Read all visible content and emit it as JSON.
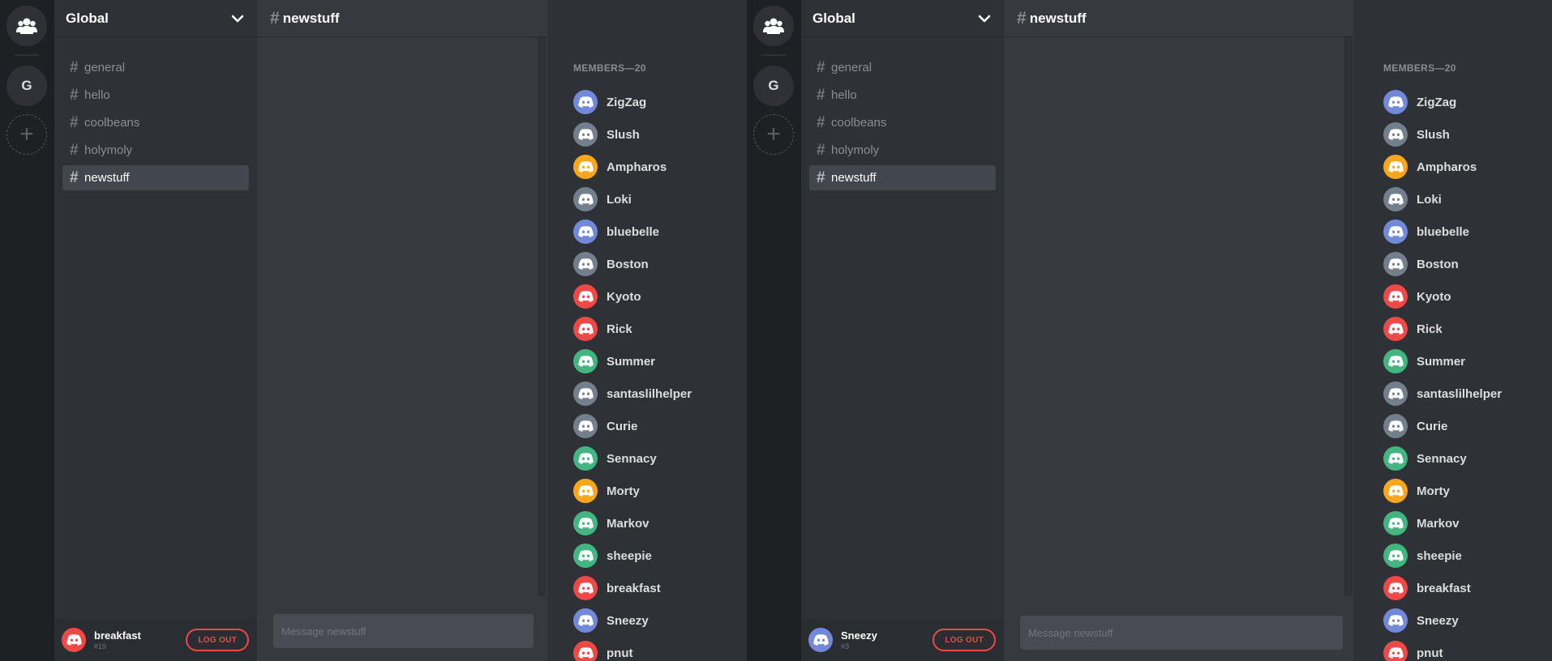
{
  "colors": {
    "blue": "#7289da",
    "grey": "#747f8d",
    "orange": "#faa61a",
    "red": "#f04747",
    "green": "#43b581"
  },
  "icons": {
    "home": "friends-icon",
    "add": "plus-icon",
    "dropdown": "chevron-down-icon",
    "avatar": "discord-logo-icon"
  },
  "panes": [
    {
      "server_initial": "G",
      "add_symbol": "+",
      "guild_name": "Global",
      "channels": [
        {
          "label": "general",
          "active": false
        },
        {
          "label": "hello",
          "active": false
        },
        {
          "label": "coolbeans",
          "active": false
        },
        {
          "label": "holymoly",
          "active": false
        },
        {
          "label": "newstuff",
          "active": true
        }
      ],
      "channel_hash": "#",
      "chat_title": "newstuff",
      "message_placeholder": "Message newstuff",
      "user": {
        "name": "breakfast",
        "discriminator": "#19",
        "avatar_color": "red"
      },
      "logout_label": "LOG OUT",
      "members_title": "MEMBERS—20",
      "members": [
        {
          "name": "ZigZag",
          "color": "blue"
        },
        {
          "name": "Slush",
          "color": "grey"
        },
        {
          "name": "Ampharos",
          "color": "orange"
        },
        {
          "name": "Loki",
          "color": "grey"
        },
        {
          "name": "bluebelle",
          "color": "blue"
        },
        {
          "name": "Boston",
          "color": "grey"
        },
        {
          "name": "Kyoto",
          "color": "red"
        },
        {
          "name": "Rick",
          "color": "red"
        },
        {
          "name": "Summer",
          "color": "green"
        },
        {
          "name": "santaslilhelper",
          "color": "grey"
        },
        {
          "name": "Curie",
          "color": "grey"
        },
        {
          "name": "Sennacy",
          "color": "green"
        },
        {
          "name": "Morty",
          "color": "orange"
        },
        {
          "name": "Markov",
          "color": "green"
        },
        {
          "name": "sheepie",
          "color": "green"
        },
        {
          "name": "breakfast",
          "color": "red"
        },
        {
          "name": "Sneezy",
          "color": "blue"
        },
        {
          "name": "pnut",
          "color": "red"
        }
      ]
    },
    {
      "server_initial": "G",
      "add_symbol": "+",
      "guild_name": "Global",
      "channels": [
        {
          "label": "general",
          "active": false
        },
        {
          "label": "hello",
          "active": false
        },
        {
          "label": "coolbeans",
          "active": false
        },
        {
          "label": "holymoly",
          "active": false
        },
        {
          "label": "newstuff",
          "active": true
        }
      ],
      "channel_hash": "#",
      "chat_title": "newstuff",
      "message_placeholder": "Message newstuff",
      "user": {
        "name": "Sneezy",
        "discriminator": "#3",
        "avatar_color": "blue"
      },
      "logout_label": "LOG OUT",
      "members_title": "MEMBERS—20",
      "members": [
        {
          "name": "ZigZag",
          "color": "blue"
        },
        {
          "name": "Slush",
          "color": "grey"
        },
        {
          "name": "Ampharos",
          "color": "orange"
        },
        {
          "name": "Loki",
          "color": "grey"
        },
        {
          "name": "bluebelle",
          "color": "blue"
        },
        {
          "name": "Boston",
          "color": "grey"
        },
        {
          "name": "Kyoto",
          "color": "red"
        },
        {
          "name": "Rick",
          "color": "red"
        },
        {
          "name": "Summer",
          "color": "green"
        },
        {
          "name": "santaslilhelper",
          "color": "grey"
        },
        {
          "name": "Curie",
          "color": "grey"
        },
        {
          "name": "Sennacy",
          "color": "green"
        },
        {
          "name": "Morty",
          "color": "orange"
        },
        {
          "name": "Markov",
          "color": "green"
        },
        {
          "name": "sheepie",
          "color": "green"
        },
        {
          "name": "breakfast",
          "color": "red"
        },
        {
          "name": "Sneezy",
          "color": "blue"
        },
        {
          "name": "pnut",
          "color": "red"
        }
      ]
    }
  ]
}
